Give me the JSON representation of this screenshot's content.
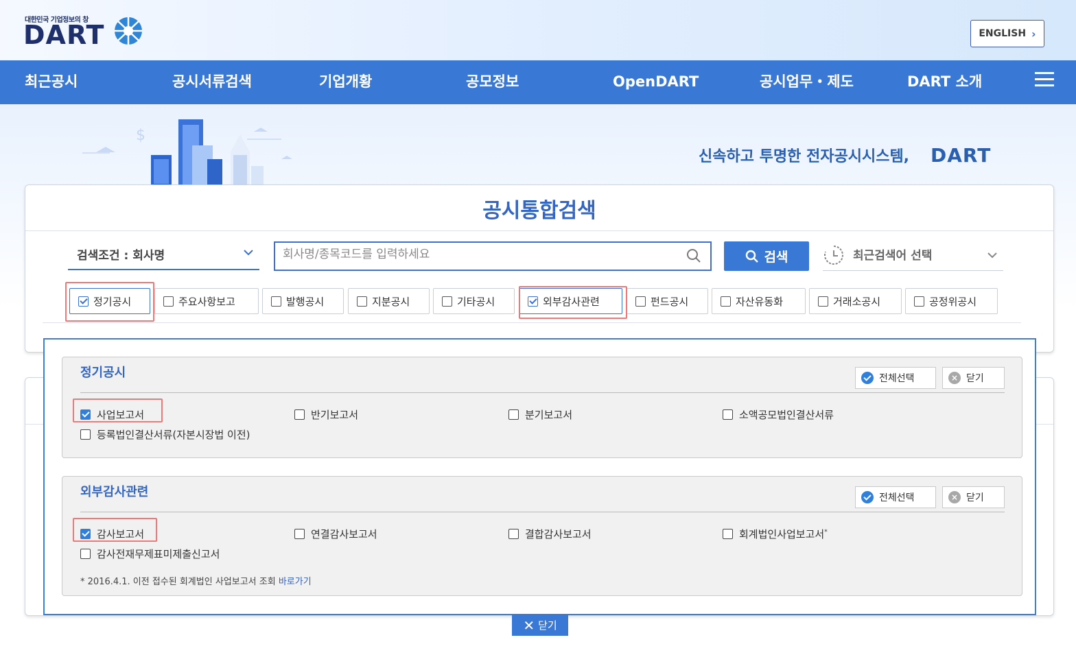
{
  "header": {
    "logo_tagline": "대한민국 기업정보의 창",
    "logo_text": "DART",
    "language_button": "ENGLISH"
  },
  "nav": {
    "items": [
      "최근공시",
      "공시서류검색",
      "기업개황",
      "공모정보",
      "OpenDART",
      "공시업무・제도",
      "DART 소개"
    ]
  },
  "banner": {
    "slogan": "신속하고 투명한 전자공시시스템,",
    "slogan_brand": "DART"
  },
  "search": {
    "title": "공시통합검색",
    "condition_label": "검색조건 : 회사명",
    "input_placeholder": "회사명/종목코드를 입력하세요",
    "input_value": "",
    "search_button": "검색",
    "recent_label": "최근검색어 선택"
  },
  "filters": [
    {
      "label": "정기공시",
      "checked": true
    },
    {
      "label": "주요사항보고",
      "checked": false
    },
    {
      "label": "발행공시",
      "checked": false
    },
    {
      "label": "지분공시",
      "checked": false
    },
    {
      "label": "기타공시",
      "checked": false
    },
    {
      "label": "외부감사관련",
      "checked": true
    },
    {
      "label": "펀드공시",
      "checked": false
    },
    {
      "label": "자산유동화",
      "checked": false
    },
    {
      "label": "거래소공시",
      "checked": false
    },
    {
      "label": "공정위공시",
      "checked": false
    }
  ],
  "panel": {
    "select_all": "전체선택",
    "close": "닫기",
    "groups": [
      {
        "title": "정기공시",
        "options": [
          {
            "label": "사업보고서",
            "checked": true
          },
          {
            "label": "반기보고서",
            "checked": false
          },
          {
            "label": "분기보고서",
            "checked": false
          },
          {
            "label": "소액공모법인결산서류",
            "checked": false
          },
          {
            "label": "등록법인결산서류(자본시장법 이전)",
            "checked": false
          }
        ]
      },
      {
        "title": "외부감사관련",
        "options": [
          {
            "label": "감사보고서",
            "checked": true
          },
          {
            "label": "연결감사보고서",
            "checked": false
          },
          {
            "label": "결합감사보고서",
            "checked": false
          },
          {
            "label": "회계법인사업보고서",
            "checked": false,
            "mark": "*"
          },
          {
            "label": "감사전재무제표미제출신고서",
            "checked": false
          }
        ],
        "note": "* 2016.4.1. 이전 접수된 회계법인 사업보고서 조회",
        "note_link": "바로가기"
      }
    ],
    "bottom_close": "닫기"
  },
  "colors": {
    "nav_bg": "#3a78d5",
    "accent": "#3366c4",
    "highlight": "#f07878"
  }
}
